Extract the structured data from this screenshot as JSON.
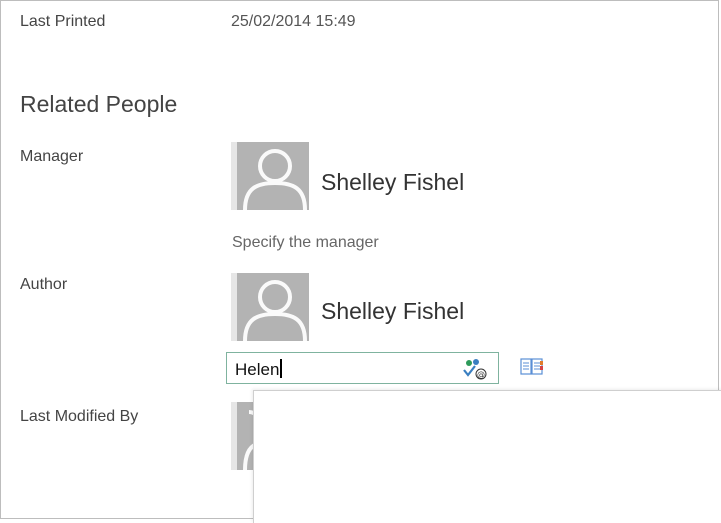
{
  "last_printed": {
    "label": "Last Printed",
    "value": "25/02/2014 15:49"
  },
  "related_people": {
    "title": "Related People",
    "manager": {
      "label": "Manager",
      "name": "Shelley Fishel",
      "hint": "Specify the manager"
    },
    "author": {
      "label": "Author",
      "name": "Shelley Fishel",
      "input_value": "Helen"
    },
    "last_modified_by": {
      "label": "Last Modified By"
    }
  }
}
